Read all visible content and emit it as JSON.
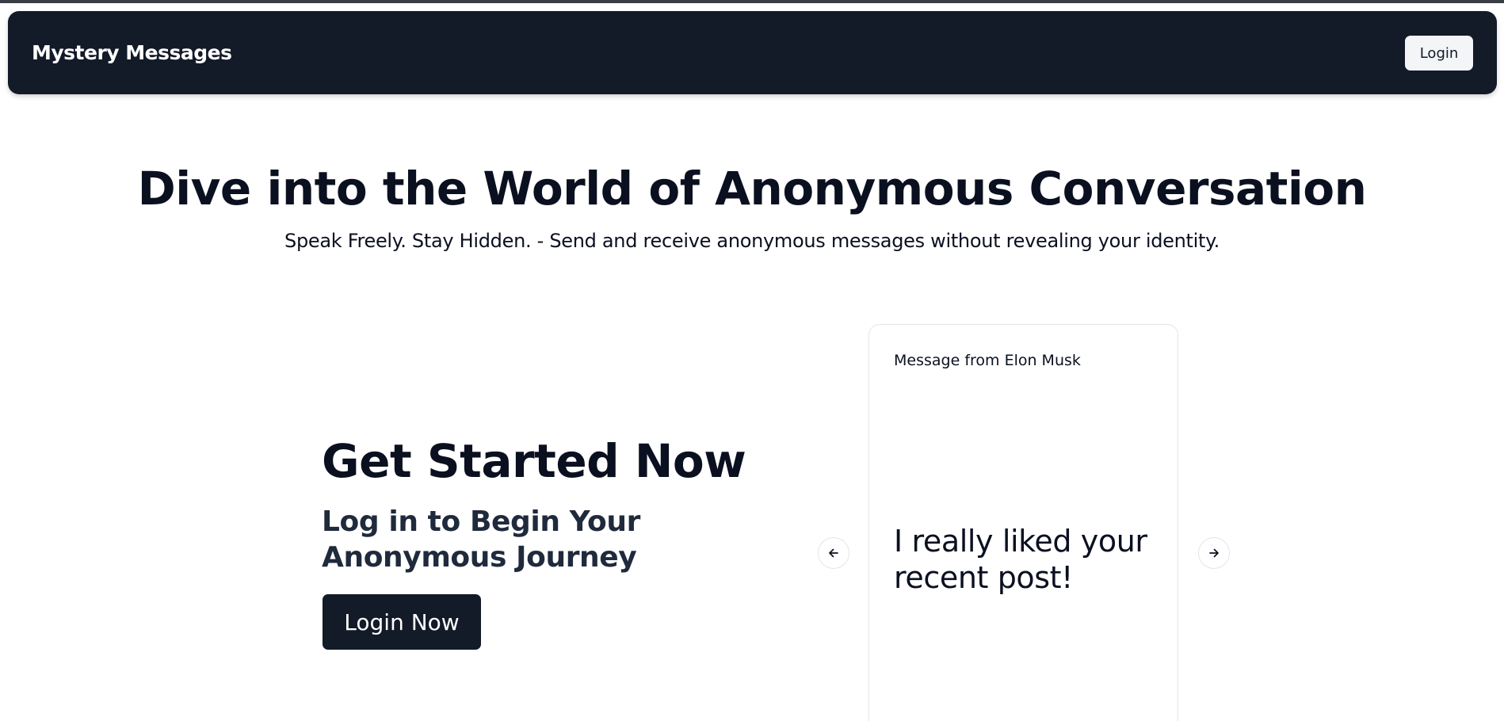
{
  "navbar": {
    "brand": "Mystery Messages",
    "login_label": "Login"
  },
  "hero": {
    "title": "Dive into the World of Anonymous Conversation",
    "subtitle": "Speak Freely. Stay Hidden. - Send and receive anonymous messages without revealing your identity."
  },
  "cta": {
    "title": "Get Started Now",
    "subtitle": "Log in to Begin Your Anonymous Journey",
    "button_label": "Login Now"
  },
  "carousel": {
    "prev_icon": "arrow-left-icon",
    "next_icon": "arrow-right-icon",
    "message": {
      "header": "Message from Elon Musk",
      "body": "I really liked your recent post!"
    }
  },
  "colors": {
    "navbar_bg": "#131a28",
    "text_primary": "#0b1020",
    "button_light": "#f4f5f7"
  }
}
